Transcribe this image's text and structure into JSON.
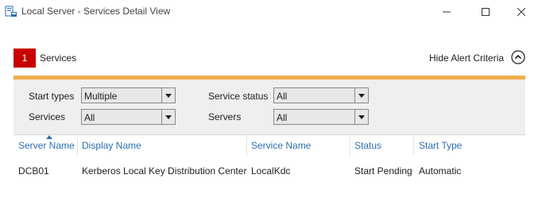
{
  "window": {
    "title": "Local Server - Services Detail View"
  },
  "header": {
    "alert_count": "1",
    "section_title": "Services",
    "hide_criteria_label": "Hide Alert Criteria"
  },
  "filters": {
    "start_types": {
      "label": "Start types",
      "value": "Multiple"
    },
    "services": {
      "label": "Services",
      "value": "All"
    },
    "service_status": {
      "label": "Service status",
      "value": "All"
    },
    "servers": {
      "label": "Servers",
      "value": "All"
    }
  },
  "grid": {
    "columns": [
      "Server Name",
      "Display Name",
      "Service Name",
      "Status",
      "Start Type"
    ],
    "sorted_column": "Server Name",
    "rows": [
      [
        "DCB01",
        "Kerberos Local Key Distribution Center",
        "LocalKdc",
        "Start Pending",
        "Automatic"
      ]
    ]
  },
  "colors": {
    "alert_badge": "#c80000",
    "criteria_bar": "#f0ad4e",
    "column_header": "#2a6fb0"
  },
  "icons": {
    "app": "services-app-icon",
    "minimize": "minimize-icon",
    "maximize": "maximize-icon",
    "close": "close-icon",
    "collapse": "chevron-up-icon",
    "dropdown": "dropdown-arrow-icon",
    "sort": "sort-ascending-icon"
  }
}
